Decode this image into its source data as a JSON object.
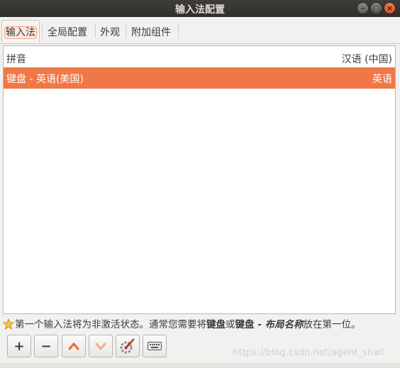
{
  "window": {
    "title": "输入法配置"
  },
  "tabs": [
    {
      "label": "输入法",
      "active": true
    },
    {
      "label": "全局配置",
      "active": false
    },
    {
      "label": "外观",
      "active": false
    },
    {
      "label": "附加组件",
      "active": false
    }
  ],
  "list": {
    "header": {
      "name": "拼音",
      "language": "汉语 (中国)"
    },
    "rows": [
      {
        "name": "键盘 - 英语(美国)",
        "language": "英语",
        "selected": true
      }
    ]
  },
  "hint": {
    "prefix": "第一个输入法将为非激活状态。通常您需要将",
    "bold1": "键盘",
    "middle": "或",
    "bold2": "键盘 - ",
    "bolditalic": "布局名称",
    "suffix": "放在第一位。"
  },
  "toolbar": {
    "add": "+",
    "remove": "−",
    "move_up_icon": "chevron-up-icon",
    "move_down_icon": "chevron-down-icon",
    "configure_icon": "configure-icon",
    "keyboard_icon": "keyboard-icon"
  },
  "watermark": "https://blog.csdn.net/agent_snail",
  "colors": {
    "accent": "#f07746",
    "titlebar": "#3a3935"
  }
}
